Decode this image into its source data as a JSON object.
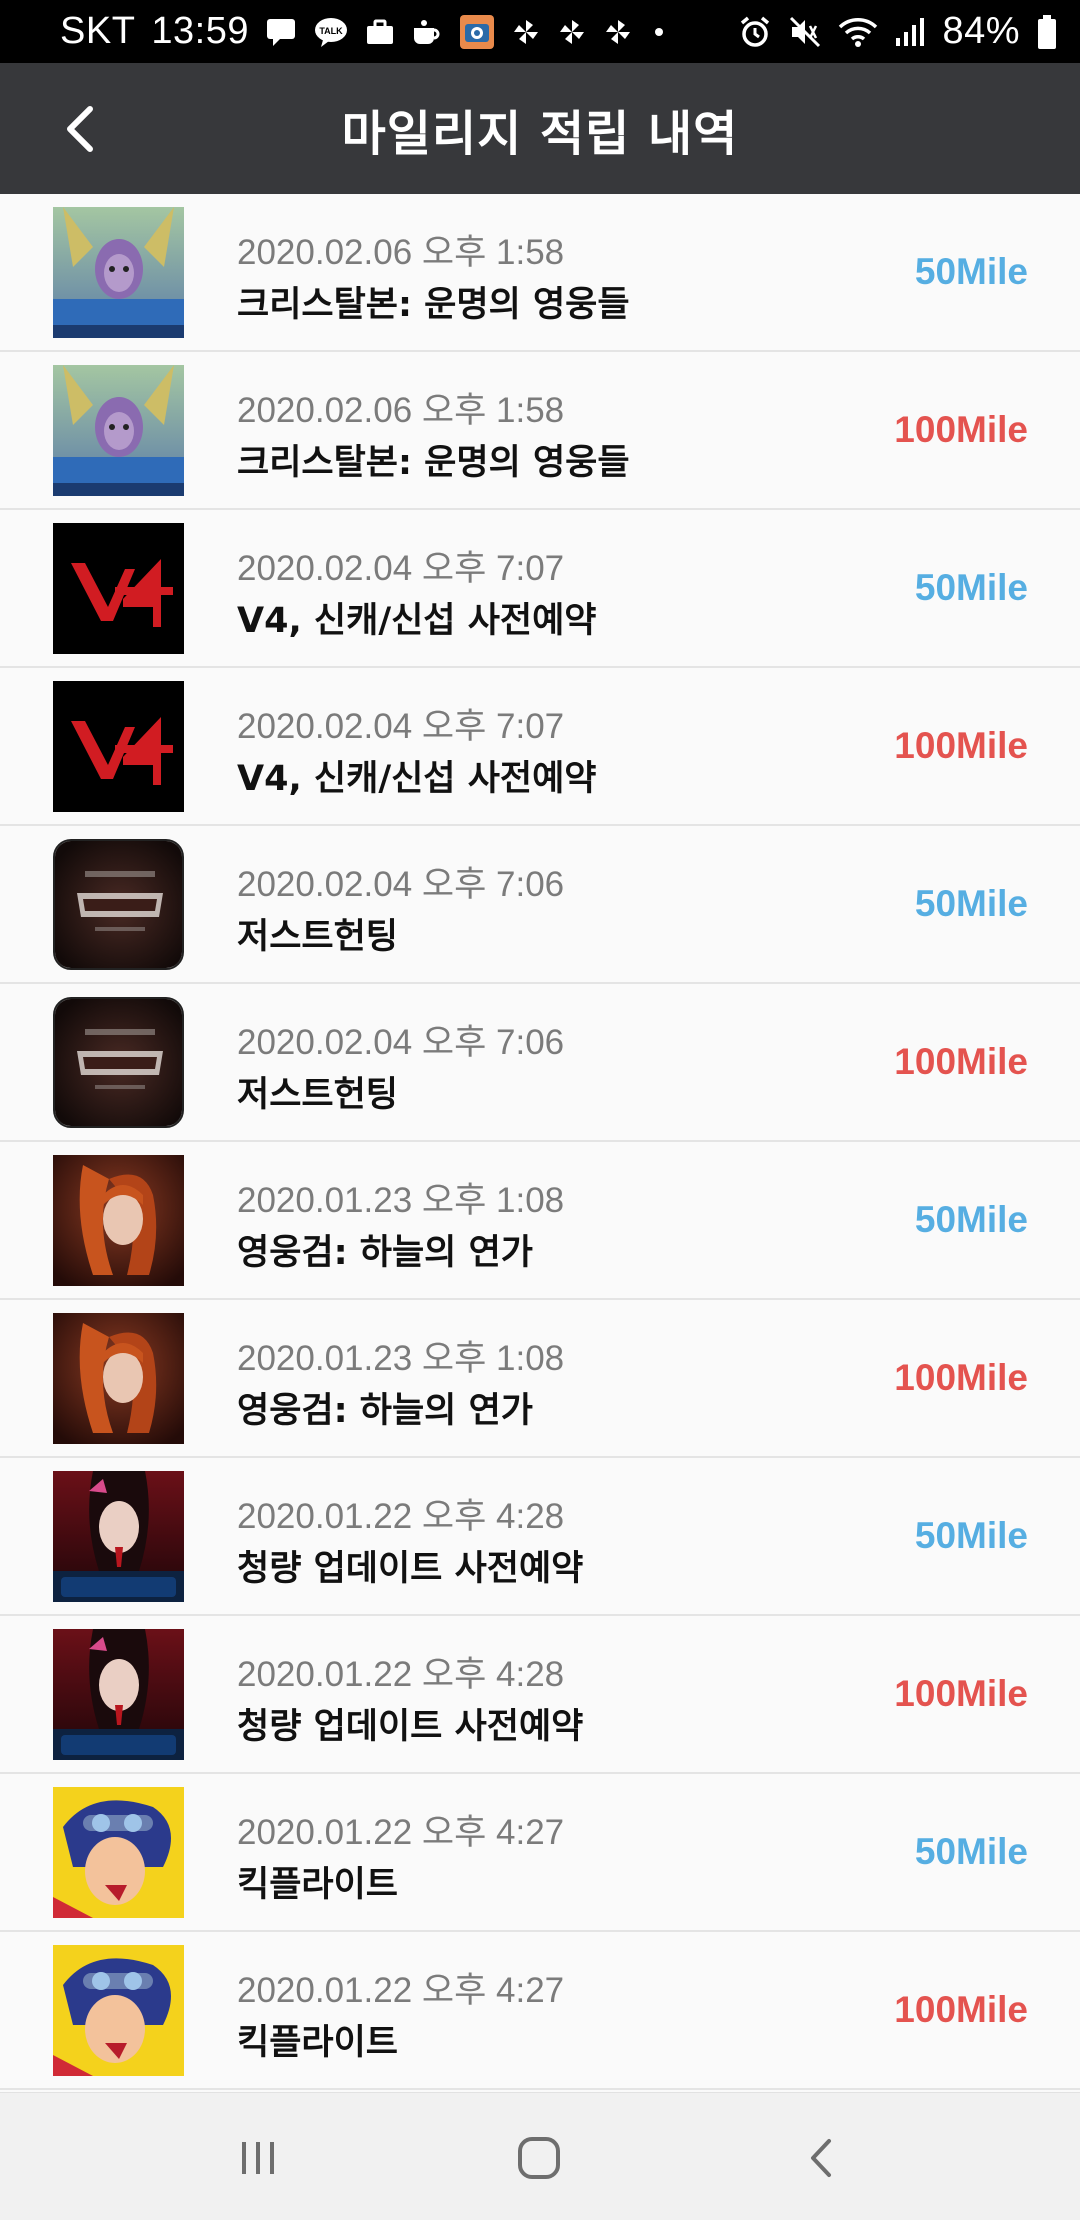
{
  "status_bar": {
    "carrier": "SKT",
    "time": "13:59",
    "battery": "84%",
    "talk_badge": "TALK"
  },
  "header": {
    "title": "마일리지 적립 내역"
  },
  "colors": {
    "mile_50": "#56aee2",
    "mile_100": "#e4534f",
    "header_bg": "#37383b"
  },
  "items": [
    {
      "date": "2020.02.06 오후 1:58",
      "name": "크리스탈본: 운명의 영웅들",
      "amount": "50Mile",
      "tier": "blue",
      "icon": "crystalborne-icon"
    },
    {
      "date": "2020.02.06 오후 1:58",
      "name": "크리스탈본: 운명의 영웅들",
      "amount": "100Mile",
      "tier": "red",
      "icon": "crystalborne-icon"
    },
    {
      "date": "2020.02.04 오후 7:07",
      "name": "V4, 신캐/신섭 사전예약",
      "amount": "50Mile",
      "tier": "blue",
      "icon": "v4-icon"
    },
    {
      "date": "2020.02.04 오후 7:07",
      "name": "V4, 신캐/신섭 사전예약",
      "amount": "100Mile",
      "tier": "red",
      "icon": "v4-icon"
    },
    {
      "date": "2020.02.04 오후 7:06",
      "name": "저스트헌팅",
      "amount": "50Mile",
      "tier": "blue",
      "icon": "just-hunting-icon"
    },
    {
      "date": "2020.02.04 오후 7:06",
      "name": "저스트헌팅",
      "amount": "100Mile",
      "tier": "red",
      "icon": "just-hunting-icon"
    },
    {
      "date": "2020.01.23 오후 1:08",
      "name": "영웅검: 하늘의 연가",
      "amount": "50Mile",
      "tier": "blue",
      "icon": "hero-sword-icon"
    },
    {
      "date": "2020.01.23 오후 1:08",
      "name": "영웅검: 하늘의 연가",
      "amount": "100Mile",
      "tier": "red",
      "icon": "hero-sword-icon"
    },
    {
      "date": "2020.01.22 오후 4:28",
      "name": "청량 업데이트 사전예약",
      "amount": "50Mile",
      "tier": "blue",
      "icon": "netblue-icon"
    },
    {
      "date": "2020.01.22 오후 4:28",
      "name": "청량 업데이트 사전예약",
      "amount": "100Mile",
      "tier": "red",
      "icon": "netblue-icon"
    },
    {
      "date": "2020.01.22 오후 4:27",
      "name": "킥플라이트",
      "amount": "50Mile",
      "tier": "blue",
      "icon": "kickflight-icon"
    },
    {
      "date": "2020.01.22 오후 4:27",
      "name": "킥플라이트",
      "amount": "100Mile",
      "tier": "red",
      "icon": "kickflight-icon"
    }
  ],
  "nav": {
    "recents": "recents-icon",
    "home": "home-icon",
    "back": "back-icon"
  }
}
